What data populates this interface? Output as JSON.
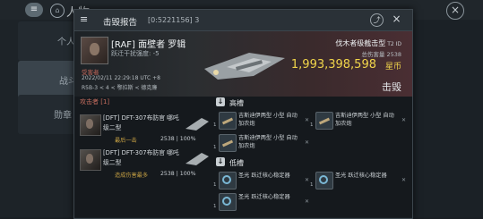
{
  "background": {
    "title": "人物",
    "sidebar": {
      "items": [
        {
          "label": "个人"
        },
        {
          "label": "战斗"
        },
        {
          "label": "勋章"
        }
      ]
    }
  },
  "window": {
    "title": "击毁报告",
    "id": "[0:5221156] 3",
    "victim": {
      "name": "[RAF] 面壁者 罗辑",
      "sub": "跃迁干扰强度: -5",
      "label": "受害者",
      "time": "2022/02/11 22:29:18 UTC +8",
      "location": "R5B-3 < 4 < 鄂拉斯 < 德克廉",
      "ship_class": "伐木者级截击型",
      "ship_tech": "T2 ID",
      "damage_label": "总伤害量 2538",
      "isk_value": "1,993,398,598",
      "isk_unit": "星币",
      "result": "击毁"
    },
    "attackers": {
      "title": "攻击者 [1]",
      "list": [
        {
          "name": "[DFT] DFT-307布防官 哪吒级二型",
          "role": "最后一击",
          "damage": "2538 | 100%"
        },
        {
          "name": "[DFT] DFT-307布防官 哪吒级二型",
          "role": "造成伤害最多",
          "damage": "2538 | 100%"
        }
      ]
    },
    "slots": {
      "high": {
        "label": "高槽",
        "modules": [
          {
            "qty": "1",
            "name": "吉斯迪伊两型 小型 自动加农炮"
          },
          {
            "qty": "1",
            "name": "吉斯迪伊两型 小型 自动加农炮"
          },
          {
            "qty": "1",
            "name": "吉斯迪伊两型 小型 自动加农炮"
          }
        ]
      },
      "low": {
        "label": "低槽",
        "modules": [
          {
            "qty": "1",
            "name": "圣光 跃迁核心稳定器"
          },
          {
            "qty": "1",
            "name": "圣光 跃迁核心稳定器"
          },
          {
            "qty": "1",
            "name": "圣光 跃迁核心稳定器"
          }
        ]
      }
    }
  }
}
